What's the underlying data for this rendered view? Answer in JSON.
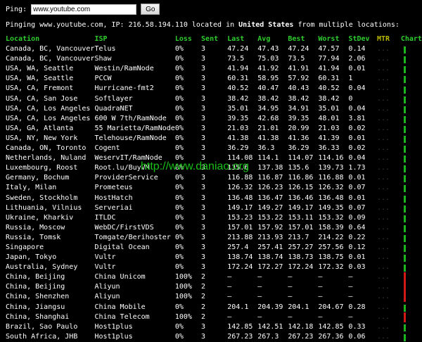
{
  "ping": {
    "label": "Ping:",
    "value": "www.youtube.com",
    "button": "Go"
  },
  "summary": {
    "prefix": "Pinging www.youtube.com, IP: 216.58.194.110 located in ",
    "country": "United States",
    "suffix": " from multiple locations:"
  },
  "headers": {
    "location": "Location",
    "isp": "ISP",
    "loss": "Loss",
    "sent": "Sent",
    "last": "Last",
    "avg": "Avg",
    "best": "Best",
    "worst": "Worst",
    "stdev": "StDev",
    "mtr": "MTR",
    "chart": "Chart"
  },
  "mtr_text": "...",
  "watermark": "http://www.daniao.org",
  "colors": {
    "header": "#2ecc2e",
    "mtr_header": "#b7b700",
    "bar_ok": "#1db51d",
    "bar_loss": "#d41919"
  },
  "rows": [
    {
      "loc": "Canada, BC, Vancouver",
      "isp": "Telus",
      "loss": "0%",
      "sent": "3",
      "last": "47.24",
      "avg": "47.43",
      "best": "47.24",
      "worst": "47.57",
      "stdev": "0.14",
      "bar": "ok"
    },
    {
      "loc": "Canada, BC, Vancouver",
      "isp": "Shaw",
      "loss": "0%",
      "sent": "3",
      "last": "73.5",
      "avg": "75.03",
      "best": "73.5",
      "worst": "77.94",
      "stdev": "2.06",
      "bar": "ok"
    },
    {
      "loc": "USA, WA, Seattle",
      "isp": "Westin/RamNode",
      "loss": "0%",
      "sent": "3",
      "last": "41.94",
      "avg": "41.92",
      "best": "41.91",
      "worst": "41.94",
      "stdev": "0.01",
      "bar": "ok"
    },
    {
      "loc": "USA, WA, Seattle",
      "isp": "PCCW",
      "loss": "0%",
      "sent": "3",
      "last": "60.31",
      "avg": "58.95",
      "best": "57.92",
      "worst": "60.31",
      "stdev": "1",
      "bar": "ok"
    },
    {
      "loc": "USA, CA, Fremont",
      "isp": "Hurricane-fmt2",
      "loss": "0%",
      "sent": "3",
      "last": "40.52",
      "avg": "40.47",
      "best": "40.43",
      "worst": "40.52",
      "stdev": "0.04",
      "bar": "ok"
    },
    {
      "loc": "USA, CA, San Jose",
      "isp": "Softlayer",
      "loss": "0%",
      "sent": "3",
      "last": "38.42",
      "avg": "38.42",
      "best": "38.42",
      "worst": "38.42",
      "stdev": "0",
      "bar": "ok"
    },
    {
      "loc": "USA, CA, Los Angeles",
      "isp": "QuadraNET",
      "loss": "0%",
      "sent": "3",
      "last": "35.01",
      "avg": "34.95",
      "best": "34.91",
      "worst": "35.01",
      "stdev": "0.04",
      "bar": "ok"
    },
    {
      "loc": "USA, CA, Los Angeles",
      "isp": "600 W 7th/RamNode",
      "loss": "0%",
      "sent": "3",
      "last": "39.35",
      "avg": "42.68",
      "best": "39.35",
      "worst": "48.01",
      "stdev": "3.81",
      "bar": "ok"
    },
    {
      "loc": "USA, GA, Atlanta",
      "isp": "55 Marietta/RamNode",
      "loss": "0%",
      "sent": "3",
      "last": "21.03",
      "avg": "21.01",
      "best": "20.99",
      "worst": "21.03",
      "stdev": "0.02",
      "bar": "ok"
    },
    {
      "loc": "USA, NY, New York",
      "isp": "Telehouse/RamNode",
      "loss": "0%",
      "sent": "3",
      "last": "41.38",
      "avg": "41.38",
      "best": "41.36",
      "worst": "41.39",
      "stdev": "0.01",
      "bar": "ok"
    },
    {
      "loc": "Canada, ON, Toronto",
      "isp": "Cogent",
      "loss": "0%",
      "sent": "3",
      "last": "36.29",
      "avg": "36.3",
      "best": "36.29",
      "worst": "36.33",
      "stdev": "0.02",
      "bar": "ok"
    },
    {
      "loc": "Netherlands, Nuland",
      "isp": "WeservIT/RamNode",
      "loss": "0%",
      "sent": "3",
      "last": "114.08",
      "avg": "114.1",
      "best": "114.07",
      "worst": "114.16",
      "stdev": "0.04",
      "bar": "ok"
    },
    {
      "loc": "Luxembourg, Roost",
      "isp": "Root.lu/BuyVM",
      "loss": "0%",
      "sent": "3",
      "last": "135.6",
      "avg": "137.38",
      "best": "135.6",
      "worst": "139.73",
      "stdev": "1.73",
      "bar": "ok"
    },
    {
      "loc": "Germany, Bochum",
      "isp": "ProviderService",
      "loss": "0%",
      "sent": "3",
      "last": "116.88",
      "avg": "116.87",
      "best": "116.86",
      "worst": "116.88",
      "stdev": "0.01",
      "bar": "ok"
    },
    {
      "loc": "Italy, Milan",
      "isp": "Prometeus",
      "loss": "0%",
      "sent": "3",
      "last": "126.32",
      "avg": "126.23",
      "best": "126.15",
      "worst": "126.32",
      "stdev": "0.07",
      "bar": "ok"
    },
    {
      "loc": "Sweden, Stockholm",
      "isp": "HostHatch",
      "loss": "0%",
      "sent": "3",
      "last": "136.48",
      "avg": "136.47",
      "best": "136.46",
      "worst": "136.48",
      "stdev": "0.01",
      "bar": "ok"
    },
    {
      "loc": "Lithuania, Vilnius",
      "isp": "Serveriai",
      "loss": "0%",
      "sent": "3",
      "last": "149.17",
      "avg": "149.27",
      "best": "149.17",
      "worst": "149.35",
      "stdev": "0.07",
      "bar": "ok"
    },
    {
      "loc": "Ukraine, Kharkiv",
      "isp": "ITLDC",
      "loss": "0%",
      "sent": "3",
      "last": "153.23",
      "avg": "153.22",
      "best": "153.11",
      "worst": "153.32",
      "stdev": "0.09",
      "bar": "ok"
    },
    {
      "loc": "Russia, Moscow",
      "isp": "WebDC/FirstVDS",
      "loss": "0%",
      "sent": "3",
      "last": "157.01",
      "avg": "157.92",
      "best": "157.01",
      "worst": "158.39",
      "stdev": "0.64",
      "bar": "ok"
    },
    {
      "loc": "Russia, Tomsk",
      "isp": "Tomgate/Berihoster",
      "loss": "0%",
      "sent": "3",
      "last": "213.88",
      "avg": "213.93",
      "best": "213.7",
      "worst": "214.22",
      "stdev": "0.22",
      "bar": "ok"
    },
    {
      "loc": "Singapore",
      "isp": "Digital Ocean",
      "loss": "0%",
      "sent": "3",
      "last": "257.4",
      "avg": "257.41",
      "best": "257.27",
      "worst": "257.56",
      "stdev": "0.12",
      "bar": "ok"
    },
    {
      "loc": "Japan, Tokyo",
      "isp": "Vultr",
      "loss": "0%",
      "sent": "3",
      "last": "138.74",
      "avg": "138.74",
      "best": "138.73",
      "worst": "138.75",
      "stdev": "0.01",
      "bar": "ok"
    },
    {
      "loc": "Australia, Sydney",
      "isp": "Vultr",
      "loss": "0%",
      "sent": "3",
      "last": "172.24",
      "avg": "172.27",
      "best": "172.24",
      "worst": "172.32",
      "stdev": "0.03",
      "bar": "ok"
    },
    {
      "loc": "China, Beijing",
      "isp": "China Unicom",
      "loss": "100%",
      "sent": "2",
      "last": "–",
      "avg": "–",
      "best": "–",
      "worst": "–",
      "stdev": "–",
      "bar": "loss"
    },
    {
      "loc": "China, Beijing",
      "isp": "Aliyun",
      "loss": "100%",
      "sent": "2",
      "last": "–",
      "avg": "–",
      "best": "–",
      "worst": "–",
      "stdev": "–",
      "bar": "loss"
    },
    {
      "loc": "China, Shenzhen",
      "isp": "Aliyun",
      "loss": "100%",
      "sent": "2",
      "last": "–",
      "avg": "–",
      "best": "–",
      "worst": "–",
      "stdev": "–",
      "bar": "loss"
    },
    {
      "loc": "China, Jiangsu",
      "isp": "China Mobile",
      "loss": "0%",
      "sent": "2",
      "last": "204.1",
      "avg": "204.39",
      "best": "204.1",
      "worst": "204.67",
      "stdev": "0.28",
      "bar": "ok"
    },
    {
      "loc": "China, Shanghai",
      "isp": "China Telecom",
      "loss": "100%",
      "sent": "2",
      "last": "–",
      "avg": "–",
      "best": "–",
      "worst": "–",
      "stdev": "–",
      "bar": "loss"
    },
    {
      "loc": "Brazil, Sao Paulo",
      "isp": "Host1plus",
      "loss": "0%",
      "sent": "3",
      "last": "142.85",
      "avg": "142.51",
      "best": "142.18",
      "worst": "142.85",
      "stdev": "0.33",
      "bar": "ok"
    },
    {
      "loc": "South Africa, JHB",
      "isp": "Host1plus",
      "loss": "0%",
      "sent": "3",
      "last": "267.23",
      "avg": "267.3",
      "best": "267.23",
      "worst": "267.36",
      "stdev": "0.06",
      "bar": "ok"
    }
  ]
}
